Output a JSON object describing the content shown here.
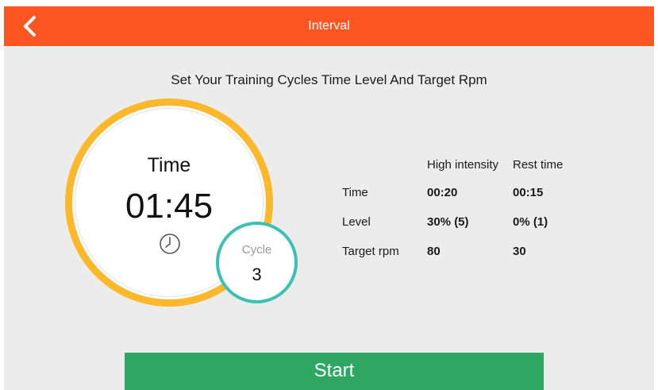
{
  "app_bar": {
    "title": "Interval",
    "back_icon": "chevron-left-icon",
    "color": "#fd5622"
  },
  "subtitle": "Set Your Training Cycles Time Level And Target Rpm",
  "time_dial": {
    "label": "Time",
    "value": "01:45",
    "icon": "clock-icon",
    "ring_color": "#fbb82a"
  },
  "cycle_badge": {
    "label": "Cycle",
    "value": "3",
    "ring_color": "#3bc1b3"
  },
  "settings": {
    "columns": [
      "High intensity",
      "Rest time"
    ],
    "rows": [
      {
        "label": "Time",
        "high": "00:20",
        "rest": "00:15"
      },
      {
        "label": "Level",
        "high": "30% (5)",
        "rest": "0% (1)"
      },
      {
        "label": "Target rpm",
        "high": "80",
        "rest": "30"
      }
    ]
  },
  "start_button": {
    "label": "Start",
    "color": "#2ea762"
  }
}
